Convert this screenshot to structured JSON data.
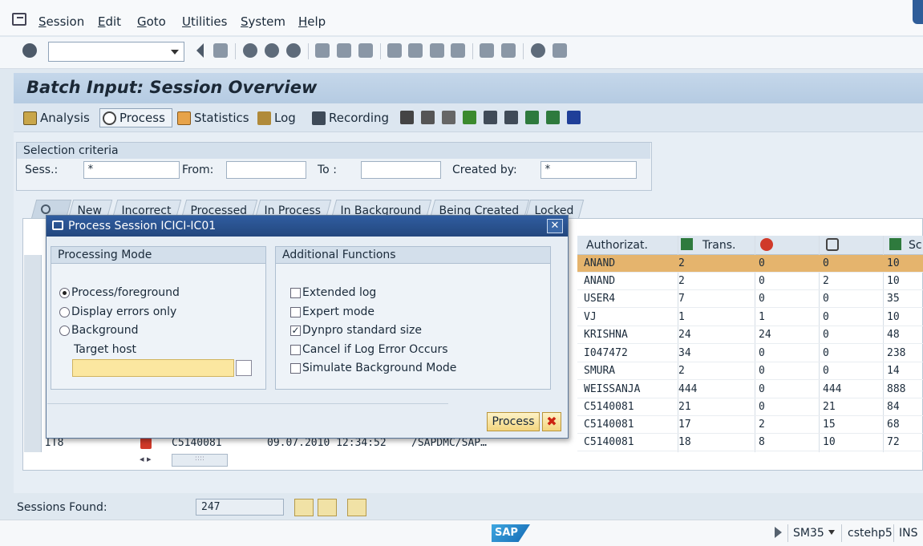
{
  "menubar": {
    "items": [
      {
        "u": "S",
        "rest": "ession"
      },
      {
        "u": "E",
        "rest": "dit"
      },
      {
        "u": "G",
        "rest": "oto"
      },
      {
        "u": "U",
        "rest": "tilities"
      },
      {
        "u": "S",
        "rest": "ystem"
      },
      {
        "u": "H",
        "rest": "elp"
      }
    ]
  },
  "toolbar": {
    "command_value": ""
  },
  "page": {
    "title": "Batch Input: Session Overview"
  },
  "app_toolbar": {
    "analysis": "Analysis",
    "process": "Process",
    "statistics": "Statistics",
    "log": "Log",
    "recording": "Recording"
  },
  "selection": {
    "title": "Selection criteria",
    "sess_label": "Sess.:",
    "sess_value": "*",
    "from_label": "From:",
    "from_value": "",
    "to_label": "To :",
    "to_value": "",
    "created_by_label": "Created by:",
    "created_by_value": "*"
  },
  "tabs": [
    "New",
    "Incorrect",
    "Processed",
    "In Process",
    "In Background",
    "Being Created",
    "Locked"
  ],
  "grid": {
    "headers": {
      "authorizat": "Authorizat.",
      "trans": "Trans.",
      "sc": "Sc"
    },
    "rows": [
      {
        "auth": "ANAND",
        "trans": "2",
        "err": "0",
        "ok": "0",
        "sc": "10"
      },
      {
        "auth": "ANAND",
        "trans": "2",
        "err": "0",
        "ok": "2",
        "sc": "10"
      },
      {
        "auth": "USER4",
        "trans": "7",
        "err": "0",
        "ok": "0",
        "sc": "35"
      },
      {
        "auth": "VJ",
        "trans": "1",
        "err": "1",
        "ok": "0",
        "sc": "10"
      },
      {
        "auth": "KRISHNA",
        "trans": "24",
        "err": "24",
        "ok": "0",
        "sc": "48"
      },
      {
        "auth": "I047472",
        "trans": "34",
        "err": "0",
        "ok": "0",
        "sc": "238"
      },
      {
        "auth": "SMURA",
        "trans": "2",
        "err": "0",
        "ok": "0",
        "sc": "14"
      },
      {
        "auth": "WEISSANJA",
        "trans": "444",
        "err": "0",
        "ok": "444",
        "sc": "888"
      },
      {
        "auth": "C5140081",
        "trans": "21",
        "err": "0",
        "ok": "21",
        "sc": "84"
      },
      {
        "auth": "C5140081",
        "trans": "17",
        "err": "2",
        "ok": "15",
        "sc": "68"
      },
      {
        "auth": "C5140081",
        "trans": "18",
        "err": "8",
        "ok": "10",
        "sc": "72"
      }
    ],
    "last_row_left": {
      "name": "IT8",
      "created_by": "C5140081",
      "date_time": "09.07.2010 12:34:52",
      "queue": "/SAPDMC/SAP…"
    },
    "hscroll_thumb": "::::"
  },
  "dialog": {
    "title": "Process Session ICICI-IC01",
    "processing_mode_title": "Processing Mode",
    "additional_functions_title": "Additional Functions",
    "mode_options": [
      {
        "label": "Process/foreground",
        "selected": true
      },
      {
        "label": "Display errors only",
        "selected": false
      },
      {
        "label": "Background",
        "selected": false
      }
    ],
    "target_host_label": "Target host",
    "target_host_value": "",
    "functions": [
      {
        "label": "Extended log",
        "checked": false
      },
      {
        "label": "Expert mode",
        "checked": false
      },
      {
        "label": "Dynpro standard size",
        "checked": true
      },
      {
        "label": "Cancel if Log Error Occurs",
        "checked": false
      },
      {
        "label": "Simulate Background Mode",
        "checked": false
      }
    ],
    "process_button": "Process",
    "close_glyph": "✕",
    "cancel_glyph": "✖"
  },
  "footer": {
    "sessions_found_label": "Sessions Found:",
    "sessions_found_value": "247"
  },
  "status": {
    "logo": "SAP",
    "transaction": "SM35",
    "server": "cstehp5",
    "mode": "INS"
  },
  "colors": {
    "selected_row": "#e5b46d",
    "dialog_title": "#2a5291",
    "host_field": "#fbe7a0"
  }
}
